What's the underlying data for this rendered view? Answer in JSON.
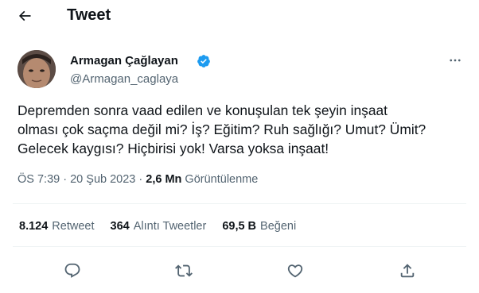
{
  "header": {
    "title": "Tweet"
  },
  "author": {
    "name": "Armagan Çağlayan",
    "handle": "@Armagan_caglaya"
  },
  "tweet": {
    "text": "Depremden sonra vaad edilen ve konuşulan tek şeyin inşaat\nolması çok saçma değil mi? İş? Eğitim? Ruh sağlığı? Umut? Ümit?\nGelecek kaygısı? Hiçbirisi yok! Varsa yoksa inşaat!",
    "time": "ÖS 7:39",
    "separator": "·",
    "date": "20 Şub 2023",
    "views_count": "2,6 Mn",
    "views_label": "Görüntülenme"
  },
  "stats": {
    "retweets": {
      "count": "8.124",
      "label": "Retweet"
    },
    "quotes": {
      "count": "364",
      "label": "Alıntı Tweetler"
    },
    "likes": {
      "count": "69,5 B",
      "label": "Beğeni"
    }
  },
  "colors": {
    "verified": "#1d9bf0",
    "secondary_text": "#536471",
    "divider": "#eff3f4"
  },
  "icons": [
    "back-arrow-icon",
    "verified-badge-icon",
    "more-icon",
    "reply-icon",
    "retweet-icon",
    "like-icon",
    "share-icon"
  ]
}
